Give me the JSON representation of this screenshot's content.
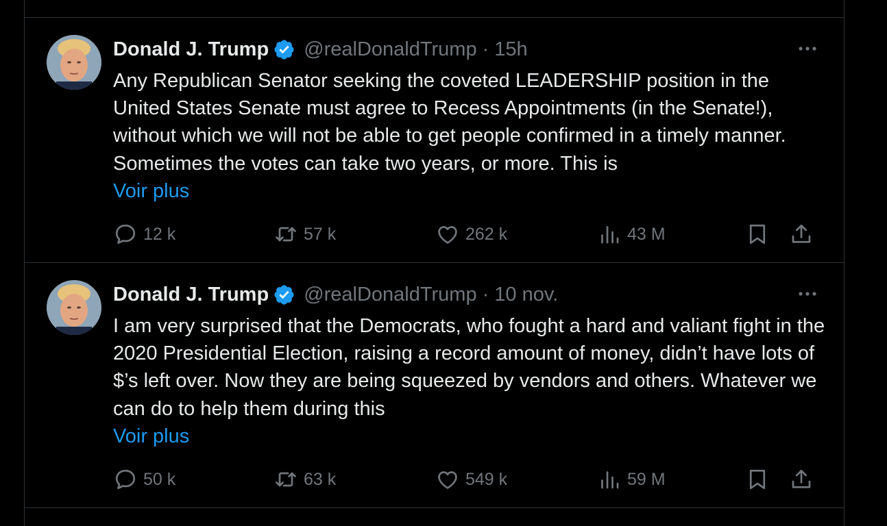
{
  "tweets": [
    {
      "author_name": "Donald J. Trump",
      "handle": "@realDonaldTrump",
      "separator": "·",
      "time": "15h",
      "text": "Any Republican Senator seeking the coveted LEADERSHIP position in the United States Senate must agree to Recess Appointments (in the Senate!), without which we will not be able to get people confirmed in a timely manner. Sometimes the votes can take two years, or more. This is",
      "show_more": "Voir plus",
      "replies": "12 k",
      "reposts": "57 k",
      "likes": "262 k",
      "views": "43 M"
    },
    {
      "author_name": "Donald J. Trump",
      "handle": "@realDonaldTrump",
      "separator": "·",
      "time": "10 nov.",
      "text": "I am very surprised that the Democrats, who fought a hard and valiant fight in the 2020 Presidential Election, raising a record amount of money, didn’t have lots of $’s left over. Now they are being squeezed by vendors and others. Whatever we can do to help them during this",
      "show_more": "Voir plus",
      "replies": "50 k",
      "reposts": "63 k",
      "likes": "549 k",
      "views": "59 M"
    }
  ],
  "colors": {
    "background": "#000000",
    "text": "#e7e9ea",
    "secondary": "#71767b",
    "accent": "#1d9bf0",
    "border": "#2f3336"
  },
  "icons": [
    "verified-badge-icon",
    "more-icon",
    "reply-icon",
    "repost-icon",
    "like-icon",
    "views-icon",
    "bookmark-icon",
    "share-icon"
  ]
}
